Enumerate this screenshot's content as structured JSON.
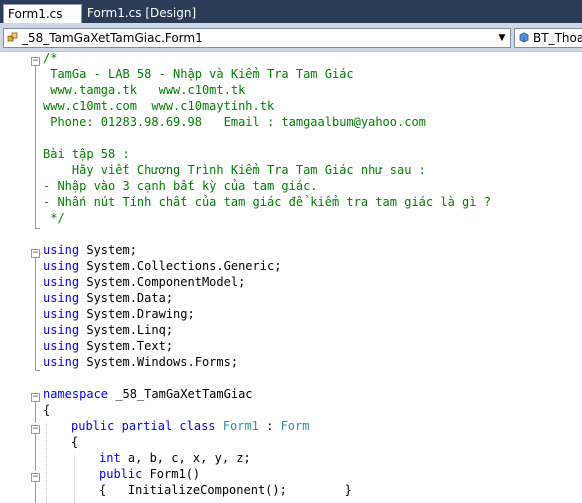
{
  "tabs": [
    {
      "label": "Form1.cs",
      "active": true
    },
    {
      "label": "Form1.cs [Design]",
      "active": false
    }
  ],
  "nav": {
    "type_selector": "_58_TamGaXetTamGiac.Form1",
    "member_selector": "BT_Thoat"
  },
  "colors": {
    "comment": "#008000",
    "keyword": "#0000ff",
    "type": "#2b91af",
    "tab_bar": "#2b3c59",
    "nav_bar": "#cfd6e5"
  },
  "code": {
    "l0": "/*",
    "l1": " TamGa - LAB 58 - Nhập và Kiểm Tra Tam Giác",
    "l2": " www.tamga.tk   www.c10mt.tk",
    "l3": "www.c10mt.com  www.c10maytinh.tk",
    "l4": " Phone: 01283.98.69.98   Email : tamgaalbum@yahoo.com",
    "l5": "",
    "l6": "Bài tập 58 :",
    "l7": "    Hãy viết Chương Trình Kiểm Tra Tam Giác như sau :",
    "l8": "- Nhập vào 3 cạnh bất kỳ của tam giác.",
    "l9": "- Nhấn nút Tính chất của tam giác để kiểm tra tam giác là gì ?",
    "l10": " */",
    "using_kw": "using",
    "u1": " System;",
    "u2": " System.Collections.Generic;",
    "u3": " System.ComponentModel;",
    "u4": " System.Data;",
    "u5": " System.Drawing;",
    "u6": " System.Linq;",
    "u7": " System.Text;",
    "u8": " System.Windows.Forms;",
    "ns_kw": "namespace",
    "ns_name": " _58_TamGaXetTamGiac",
    "brace_open": "{",
    "public_kw": "public",
    "partial_kw": "partial",
    "class_kw": "class",
    "class_name": "Form1",
    "colon": " : ",
    "base_type": "Form",
    "int_kw": "int",
    "int_vars": " a, b, c, x, y, z;",
    "ctor": " Form1()",
    "init_call": "{   InitializeComponent();        }"
  }
}
